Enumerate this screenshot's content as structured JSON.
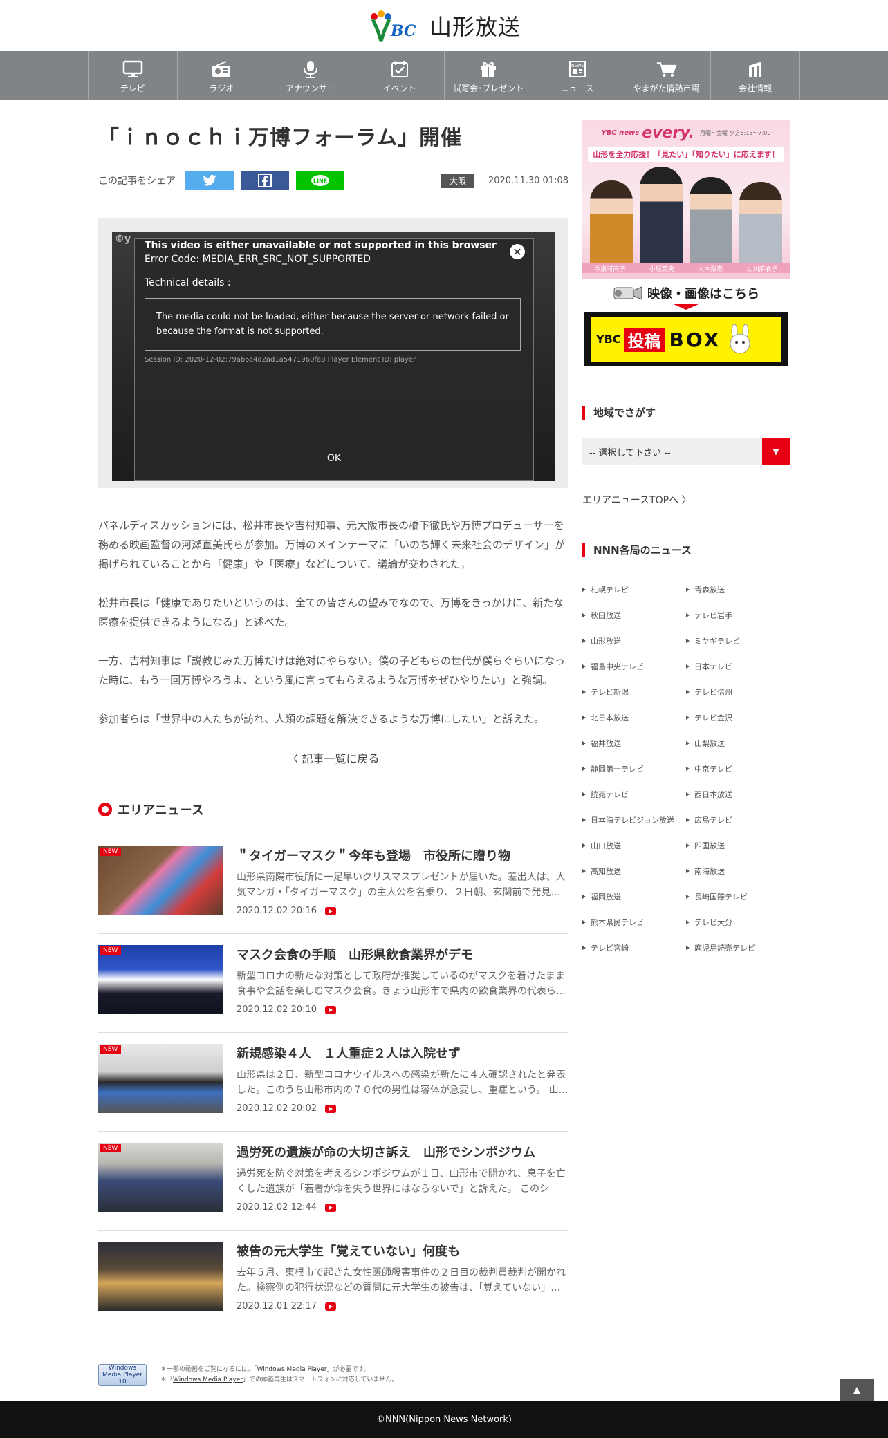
{
  "header": {
    "logo_mark": "YBC",
    "logo_text": "山形放送"
  },
  "nav": [
    {
      "label": "テレビ",
      "icon": "tv-icon"
    },
    {
      "label": "ラジオ",
      "icon": "radio-icon"
    },
    {
      "label": "アナウンサー",
      "icon": "microphone-icon"
    },
    {
      "label": "イベント",
      "icon": "calendar-check-icon"
    },
    {
      "label": "試写会･プレゼント",
      "icon": "gift-icon"
    },
    {
      "label": "ニュース",
      "icon": "news-icon"
    },
    {
      "label": "やまがた情熱市場",
      "icon": "cart-icon"
    },
    {
      "label": "会社情報",
      "icon": "building-icon"
    }
  ],
  "article": {
    "title": "「ｉｎｏｃｈｉ万博フォーラム」開催",
    "share_label": "この記事をシェア",
    "region": "大阪",
    "date": "2020.11.30 01:08",
    "paragraphs": [
      "パネルディスカッションには、松井市長や吉村知事、元大阪市長の橋下徹氏や万博プロデューサーを務める映画監督の河瀬直美氏らが参加。万博のメインテーマに「いのち輝く未来社会のデザイン」が掲げられていることから「健康」や「医療」などについて、議論が交わされた。",
      "松井市長は「健康でありたいというのは、全ての皆さんの望みでなので、万博をきっかけに、新たな医療を提供できるようになる」と述べた。",
      "一方、吉村知事は「説教じみた万博だけは絶対にやらない。僕の子どもらの世代が僕らぐらいになった時に、もう一回万博やろうよ、という風に言ってもらえるような万博をぜひやりたい」と強調。",
      "参加者らは「世界中の人たちが訪れ、人類の課題を解決できるような万博にしたい」と訴えた。"
    ],
    "back_label": "記事一覧に戻る"
  },
  "video_error": {
    "logo": "©y",
    "title": "This video is either unavailable or not supported in this browser",
    "code": "Error Code: MEDIA_ERR_SRC_NOT_SUPPORTED",
    "tech": "Technical details :",
    "message": "The media could not be loaded, either because the server or network failed or because the format is not supported.",
    "session": "Session ID: 2020-12-02:79ab5c4a2ad1a5471960fa8 Player Element ID: player",
    "ok": "OK",
    "close": "✕"
  },
  "area_news": {
    "heading": "エリアニュース",
    "items": [
      {
        "badge": "NEW",
        "title": "＂タイガーマスク＂今年も登場　市役所に贈り物",
        "desc": "山形県南陽市役所に一足早いクリスマスプレゼントが届いた。差出人は、人気マンガ・「タイガーマスク」の主人公を名乗り、２日朝、玄関前で発見…",
        "date": "2020.12.02 20:16"
      },
      {
        "badge": "NEW",
        "title": "マスク会食の手順　山形県飲食業界がデモ",
        "desc": "新型コロナの新たな対策として政府が推奨しているのがマスクを着けたまま食事や会話を楽しむマスク会食。きょう山形市で県内の飲食業界の代表ら…",
        "date": "2020.12.02 20:10"
      },
      {
        "badge": "NEW",
        "title": "新規感染４人　１人重症２人は入院せず",
        "desc": "山形県は２日、新型コロナウイルスへの感染が新たに４人確認されたと発表した。このうち山形市内の７０代の男性は容体が急変し、重症という。 山…",
        "date": "2020.12.02 20:02"
      },
      {
        "badge": "NEW",
        "title": "過労死の遺族が命の大切さ訴え　山形でシンポジウム",
        "desc": "過労死を防ぐ対策を考えるシンポジウムが１日、山形市で開かれ、息子を亡くした遺族が「若者が命を失う世界にはならないで」と訴えた。 このシン…",
        "date": "2020.12.02 12:44"
      },
      {
        "badge": "",
        "title": "被告の元大学生「覚えていない」何度も",
        "desc": "去年５月、東根市で起きた女性医師殺害事件の２日目の裁判員裁判が開かれた。検察側の犯行状況などの質問に元大学生の被告は、「覚えていない」…",
        "date": "2020.12.01 22:17"
      }
    ]
  },
  "wmp": {
    "badge": "Windows Media Player 10",
    "note1_pre": "＊一部の動画をご覧になるには、「",
    "note1_link": "Windows Media Player",
    "note1_post": "」が必要です。",
    "note2_pre": "＊「",
    "note2_link": "Windows Media Player",
    "note2_post": "」での動画再生はスマートフォンに対応していません。"
  },
  "sidebar": {
    "every_banner": {
      "brand": "every.",
      "ybc_label": "YBC news",
      "time": "月曜～金曜 夕方6:15～7:00",
      "slogan": "山形を全力応援！「見たい」「知りたい」に応えます！",
      "anchors": [
        "今泉可南子",
        "小坂篤央",
        "大木梨恵",
        "山川麻衣子"
      ]
    },
    "camera_link": "映像・画像はこちら",
    "box_banner": {
      "ybc": "YBC",
      "kanji": "投稿",
      "text": "BOX"
    },
    "region_heading": "地域でさがす",
    "select_value": "-- 選択して下さい --",
    "area_top_link": "エリアニュースTOPへ",
    "nnn_heading": "NNN各局のニュース",
    "nnn_stations": [
      "札幌テレビ",
      "青森放送",
      "秋田放送",
      "テレビ岩手",
      "山形放送",
      "ミヤギテレビ",
      "福島中央テレビ",
      "日本テレビ",
      "テレビ新潟",
      "テレビ信州",
      "北日本放送",
      "テレビ金沢",
      "福井放送",
      "山梨放送",
      "静岡第一テレビ",
      "中京テレビ",
      "読売テレビ",
      "西日本放送",
      "日本海テレビジョン放送",
      "広島テレビ",
      "山口放送",
      "四国放送",
      "高知放送",
      "南海放送",
      "福岡放送",
      "長崎国際テレビ",
      "熊本県民テレビ",
      "テレビ大分",
      "テレビ宮崎",
      "鹿児島読売テレビ"
    ]
  },
  "footer": {
    "copyright": "©NNN(Nippon News Network)",
    "pagetop": "▲"
  },
  "colors": {
    "accent": "#e60012",
    "nav_bg": "#808487",
    "footer_bg": "#111111"
  }
}
